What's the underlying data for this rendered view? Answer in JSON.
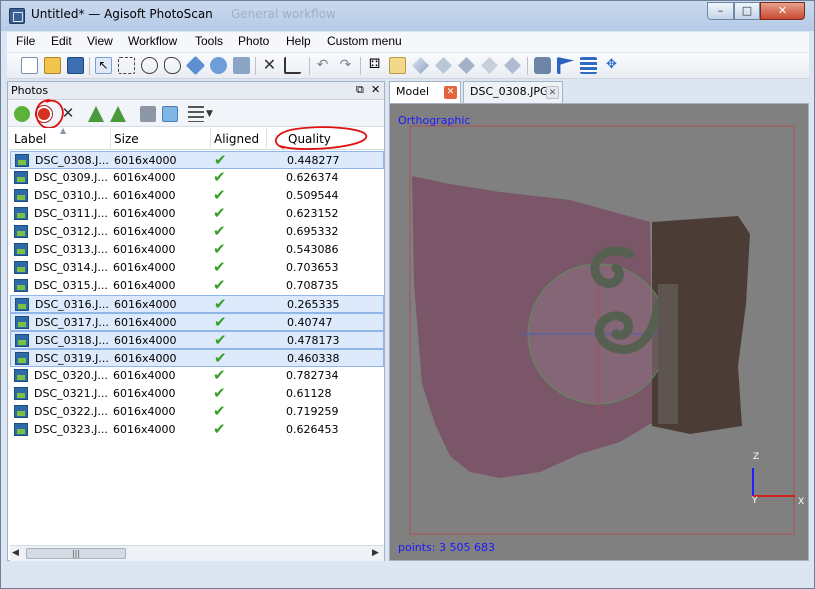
{
  "window": {
    "title": "Untitled* — Agisoft PhotoScan",
    "background_title": "General workflow",
    "controls": {
      "minimize": "–",
      "maximize": "□",
      "close": "✕"
    }
  },
  "menubar": {
    "items": [
      "File",
      "Edit",
      "View",
      "Workflow",
      "Tools",
      "Photo",
      "Help",
      "Custom menu"
    ]
  },
  "toolbar": {
    "icons": [
      "new-document-icon",
      "open-folder-icon",
      "save-icon",
      "select-pointer-icon",
      "rect-select-icon",
      "circle-select-icon",
      "free-select-icon",
      "move-object-icon",
      "rotate-object-icon",
      "scale-object-icon",
      "delete-icon",
      "crop-icon",
      "undo-icon",
      "redo-icon",
      "grid-view-icon",
      "detail-view-icon",
      "shaded-model-icon",
      "solid-model-icon",
      "wireframe-model-icon",
      "textured-model-icon",
      "camera-icon",
      "flag-icon",
      "layers-icon",
      "navigate-icon"
    ]
  },
  "photos_pane": {
    "title": "Photos",
    "float_label": "⧉",
    "close_label": "✕",
    "columns": [
      "Label",
      "Size",
      "Aligned",
      "Quality"
    ],
    "rows": [
      {
        "label": "DSC_0308.J...",
        "size": "6016x4000",
        "quality": "0.448277",
        "selected": true
      },
      {
        "label": "DSC_0309.J...",
        "size": "6016x4000",
        "quality": "0.626374",
        "selected": false
      },
      {
        "label": "DSC_0310.J...",
        "size": "6016x4000",
        "quality": "0.509544",
        "selected": false
      },
      {
        "label": "DSC_0311.J...",
        "size": "6016x4000",
        "quality": "0.623152",
        "selected": false
      },
      {
        "label": "DSC_0312.J...",
        "size": "6016x4000",
        "quality": "0.695332",
        "selected": false
      },
      {
        "label": "DSC_0313.J...",
        "size": "6016x4000",
        "quality": "0.543086",
        "selected": false
      },
      {
        "label": "DSC_0314.J...",
        "size": "6016x4000",
        "quality": "0.703653",
        "selected": false
      },
      {
        "label": "DSC_0315.J...",
        "size": "6016x4000",
        "quality": "0.708735",
        "selected": false
      },
      {
        "label": "DSC_0316.J...",
        "size": "6016x4000",
        "quality": "0.265335",
        "selected": true
      },
      {
        "label": "DSC_0317.J...",
        "size": "6016x4000",
        "quality": "0.40747",
        "selected": true
      },
      {
        "label": "DSC_0318.J...",
        "size": "6016x4000",
        "quality": "0.478173",
        "selected": true
      },
      {
        "label": "DSC_0319.J...",
        "size": "6016x4000",
        "quality": "0.460338",
        "selected": true
      },
      {
        "label": "DSC_0320.J...",
        "size": "6016x4000",
        "quality": "0.782734",
        "selected": false
      },
      {
        "label": "DSC_0321.J...",
        "size": "6016x4000",
        "quality": "0.61128",
        "selected": false
      },
      {
        "label": "DSC_0322.J...",
        "size": "6016x4000",
        "quality": "0.719259",
        "selected": false
      },
      {
        "label": "DSC_0323.J...",
        "size": "6016x4000",
        "quality": "0.626453",
        "selected": false
      }
    ],
    "scroll_grip": "|||"
  },
  "view_tabs": [
    {
      "label": "Model",
      "active": true
    },
    {
      "label": "DSC_0308.JPG",
      "active": false
    }
  ],
  "model_view": {
    "projection": "Orthographic",
    "points": "points: 3 505 683",
    "axes": {
      "z": "Z",
      "y": "Y",
      "x": "X"
    }
  },
  "colors": {
    "accent": "#3875d7",
    "checkmark": "#38a028",
    "annotation": "#e01010",
    "overlay_text": "#1a1aff"
  }
}
